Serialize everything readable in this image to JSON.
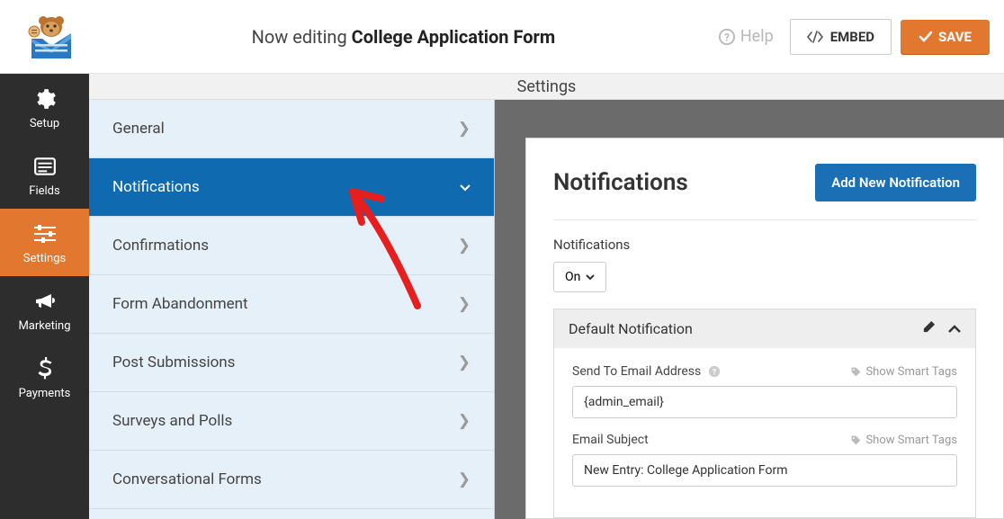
{
  "topbar": {
    "editing_prefix": "Now editing",
    "form_name": "College Application Form",
    "help_label": "Help",
    "embed_label": "EMBED",
    "save_label": "SAVE"
  },
  "sidenav": {
    "items": [
      {
        "label": "Setup"
      },
      {
        "label": "Fields"
      },
      {
        "label": "Settings"
      },
      {
        "label": "Marketing"
      },
      {
        "label": "Payments"
      }
    ]
  },
  "panel_title": "Settings",
  "settings_menu": {
    "items": [
      {
        "label": "General"
      },
      {
        "label": "Notifications"
      },
      {
        "label": "Confirmations"
      },
      {
        "label": "Form Abandonment"
      },
      {
        "label": "Post Submissions"
      },
      {
        "label": "Surveys and Polls"
      },
      {
        "label": "Conversational Forms"
      }
    ]
  },
  "editor": {
    "title": "Notifications",
    "add_button": "Add New Notification",
    "toggle_label": "Notifications",
    "toggle_value": "On",
    "block_title": "Default Notification",
    "send_to_label": "Send To Email Address",
    "send_to_value": "{admin_email}",
    "subject_label": "Email Subject",
    "subject_value": "New Entry: College Application Form",
    "smart_tags_label": "Show Smart Tags"
  }
}
